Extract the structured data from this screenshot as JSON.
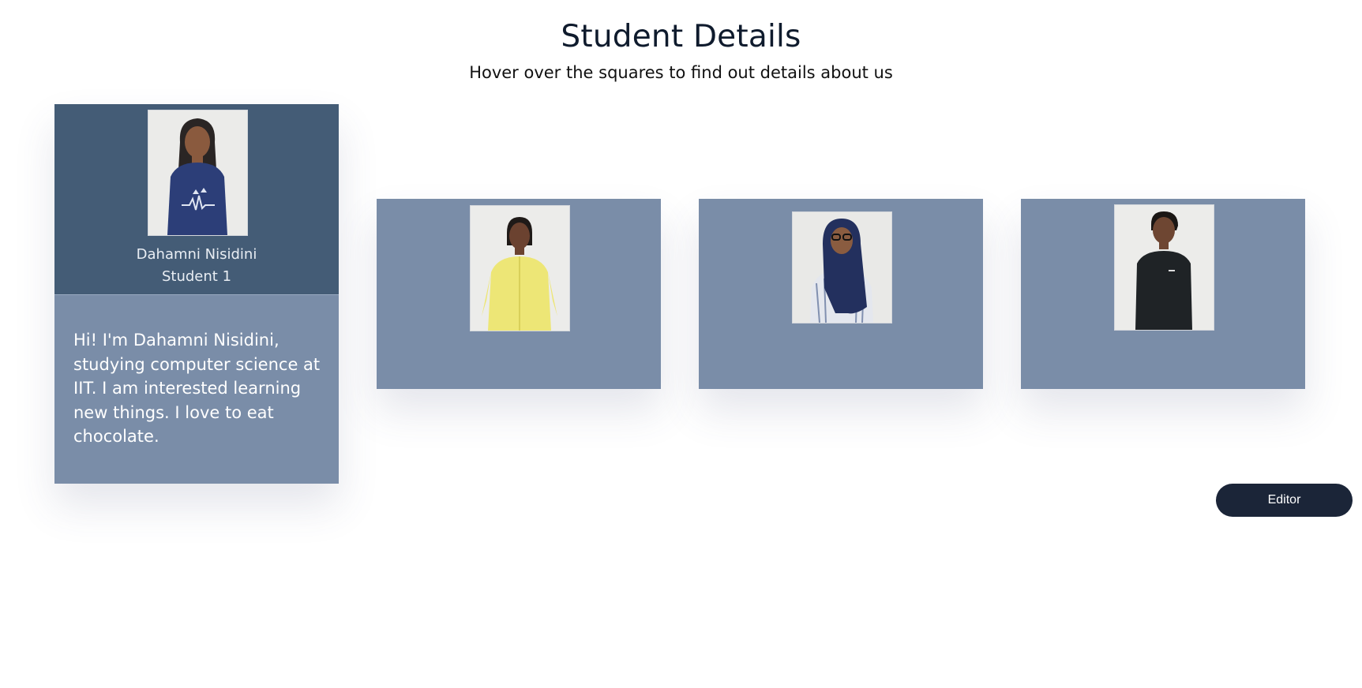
{
  "header": {
    "title": "Student Details",
    "subtitle": "Hover over the squares to find out details about us"
  },
  "students": [
    {
      "name": "Dahamni Nisidini",
      "role": "Student 1",
      "bio": "Hi! I'm Dahamni Nisidini, studying computer science at IIT. I am interested learning new things. I love to eat chocolate.",
      "expanded": true,
      "photo": "student-1-photo"
    },
    {
      "photo": "student-2-photo",
      "expanded": false
    },
    {
      "photo": "student-3-photo",
      "expanded": false
    },
    {
      "photo": "student-4-photo",
      "expanded": false
    }
  ],
  "editor_button": {
    "label": "Editor"
  },
  "colors": {
    "card": "#7a8da8",
    "card_active_top": "#445c76",
    "button": "#1b2538",
    "title": "#0f1b2d"
  }
}
